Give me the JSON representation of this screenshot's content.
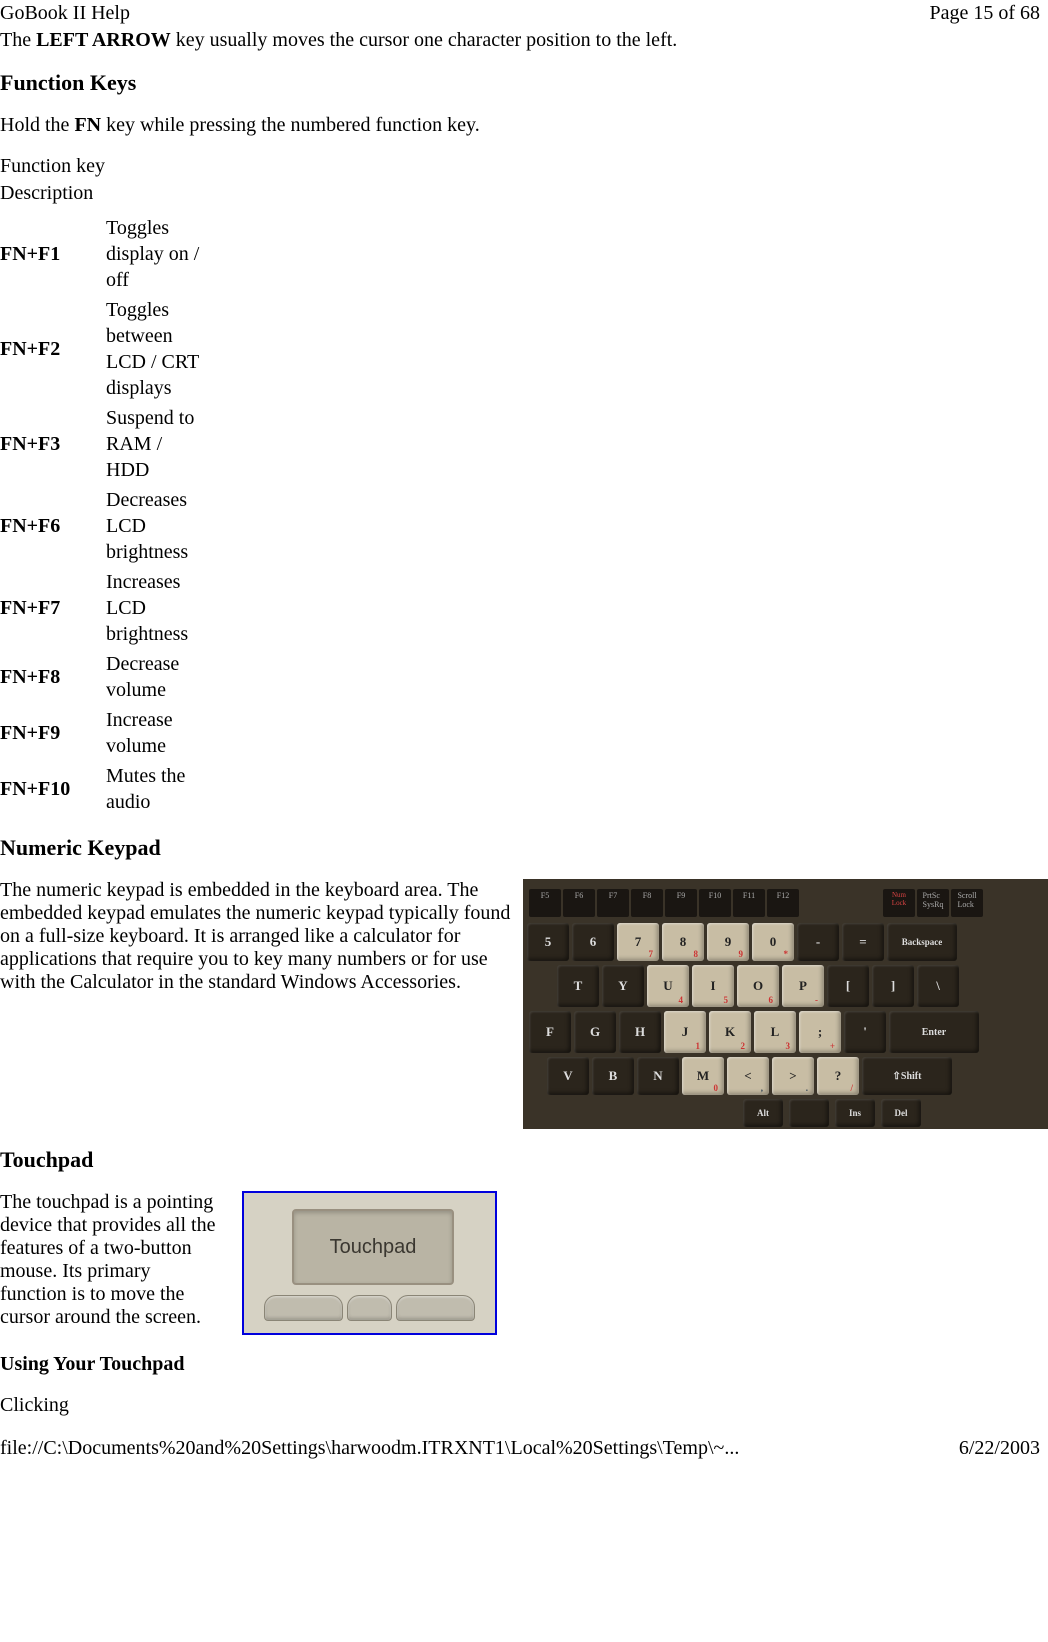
{
  "header": {
    "left": "GoBook II Help",
    "right": "Page 15 of 68"
  },
  "intro": {
    "prefix": "The ",
    "key": "LEFT ARROW",
    "suffix": " key usually moves the cursor one character position to the left."
  },
  "section_fk": {
    "heading": "Function Keys",
    "desc_prefix": "Hold the ",
    "desc_key": "FN",
    "desc_suffix": " key while pressing the numbered function key.",
    "th1": "Function key",
    "th2": "Description",
    "rows": [
      {
        "key": "FN+F1",
        "desc": "Toggles display on / off"
      },
      {
        "key": "FN+F2",
        "desc": "Toggles between LCD / CRT displays"
      },
      {
        "key": "FN+F3",
        "desc": "Suspend to RAM / HDD"
      },
      {
        "key": "FN+F6",
        "desc": "Decreases LCD brightness"
      },
      {
        "key": "FN+F7",
        "desc": "Increases LCD brightness"
      },
      {
        "key": "FN+F8",
        "desc": "Decrease volume"
      },
      {
        "key": "FN+F9",
        "desc": "Increase volume"
      },
      {
        "key": "FN+F10",
        "desc": "Mutes the audio"
      }
    ]
  },
  "section_numpad": {
    "heading": "Numeric Keypad",
    "text": "The numeric keypad is embedded in the keyboard area.   The embedded keypad emulates the numeric keypad typically found on a full-size keyboard.   It is arranged like a calculator for applications that require you to key many numbers or for use with the Calculator in the standard Windows Accessories."
  },
  "keyboard": {
    "frow": [
      "F5",
      "F6",
      "F7",
      "F8",
      "F9",
      "F10",
      "F11",
      "F12"
    ],
    "frow_extra": [
      {
        "l1": "Num",
        "l2": "Lock",
        "red": true
      },
      {
        "l1": "PrtSc",
        "l2": "SysRq"
      },
      {
        "l1": "Scroll",
        "l2": "Lock"
      }
    ],
    "r1": [
      {
        "t": "5"
      },
      {
        "t": "6"
      },
      {
        "t": "7",
        "hl": true,
        "sub": "7"
      },
      {
        "t": "8",
        "hl": true,
        "sub": "8"
      },
      {
        "t": "9",
        "hl": true,
        "sub": "9"
      },
      {
        "t": "0",
        "hl": true,
        "sub": "*"
      },
      {
        "t": "-",
        "sub": ""
      },
      {
        "t": "="
      },
      {
        "t": "Backspace",
        "wide": "wide"
      }
    ],
    "r2": [
      {
        "t": "T"
      },
      {
        "t": "Y"
      },
      {
        "t": "U",
        "hl": true,
        "sub": "4"
      },
      {
        "t": "I",
        "hl": true,
        "sub": "5"
      },
      {
        "t": "O",
        "hl": true,
        "sub": "6"
      },
      {
        "t": "P",
        "hl": true,
        "sub": "-"
      },
      {
        "t": "["
      },
      {
        "t": "]"
      },
      {
        "t": "\\"
      }
    ],
    "r3": [
      {
        "t": "F"
      },
      {
        "t": "G"
      },
      {
        "t": "H"
      },
      {
        "t": "J",
        "hl": true,
        "sub": "1"
      },
      {
        "t": "K",
        "hl": true,
        "sub": "2"
      },
      {
        "t": "L",
        "hl": true,
        "sub": "3"
      },
      {
        "t": ";",
        "hl": true,
        "sub": "+"
      },
      {
        "t": "'"
      },
      {
        "t": "Enter",
        "wide": "xwide"
      }
    ],
    "r4": [
      {
        "t": "V"
      },
      {
        "t": "B"
      },
      {
        "t": "N"
      },
      {
        "t": "M",
        "hl": true,
        "sub": "0"
      },
      {
        "t": "<",
        "hl": true,
        "subblue": ","
      },
      {
        "t": ">",
        "hl": true,
        "subblue": "."
      },
      {
        "t": "?",
        "hl": true,
        "sub": "/"
      },
      {
        "t": "⇧Shift",
        "wide": "xwide"
      }
    ],
    "r5": [
      {
        "t": "Alt",
        "small": true
      },
      {
        "t": "",
        "small": true
      },
      {
        "t": "Ins",
        "small": true
      },
      {
        "t": "Del",
        "small": true
      }
    ]
  },
  "section_touchpad": {
    "heading": "Touchpad",
    "text": "The touchpad  is a pointing device that provides all the features of a two-button mouse.   Its primary function is to move the cursor around the screen.",
    "label": "Touchpad",
    "sub_heading": "Using Your Touchpad",
    "clicking": "Clicking"
  },
  "footer": {
    "path": "file://C:\\Documents%20and%20Settings\\harwoodm.ITRXNT1\\Local%20Settings\\Temp\\~...",
    "date": "6/22/2003"
  }
}
